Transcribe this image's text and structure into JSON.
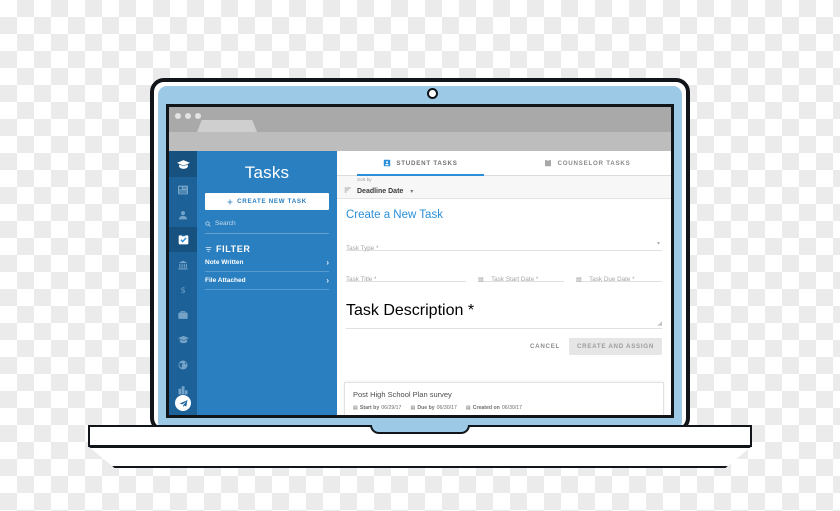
{
  "device": {
    "type": "laptop-mockup",
    "camera": "camera-dot",
    "bezel_color": "#9cc9e5",
    "frame_color": "#111418"
  },
  "browser": {
    "traffic_lights": 3,
    "tab_placeholder": "",
    "url_placeholder": ""
  },
  "rail": {
    "logo_icon": "graduation-cap-icon",
    "items": [
      {
        "icon": "list-icon",
        "active": false
      },
      {
        "icon": "person-icon",
        "active": false
      },
      {
        "icon": "clipboard-check-icon",
        "active": true
      },
      {
        "icon": "bank-icon",
        "active": false
      },
      {
        "icon": "dollar-icon",
        "active": false
      },
      {
        "icon": "briefcase-icon",
        "active": false
      },
      {
        "icon": "graduation-cap-icon",
        "active": false
      },
      {
        "icon": "globe-icon",
        "active": false
      },
      {
        "icon": "chart-building-icon",
        "active": false
      }
    ],
    "fab_icon": "paper-plane-icon"
  },
  "panel": {
    "title": "Tasks",
    "create_button": "CREATE NEW TASK",
    "create_icon": "plus-icon",
    "search_placeholder": "Search",
    "search_icon": "search-icon",
    "filter_heading": "FILTER",
    "filter_icon": "filter-icon",
    "filters": [
      {
        "label": "Note Written",
        "chevron": "chevron-right-icon"
      },
      {
        "label": "File Attached",
        "chevron": "chevron-right-icon"
      }
    ]
  },
  "main": {
    "tabs": [
      {
        "label": "STUDENT TASKS",
        "icon": "clipboard-person-icon",
        "active": true
      },
      {
        "label": "COUNSELOR TASKS",
        "icon": "clipboard-icon",
        "active": false
      }
    ],
    "sort": {
      "label": "Sort by",
      "value": "Deadline Date",
      "icon": "sort-icon",
      "caret": "▾"
    },
    "form": {
      "title": "Create a New Task",
      "task_type_label": "Task Type *",
      "task_type_caret": "▾",
      "task_title_label": "Task Title *",
      "task_start_date_label": "Task Start Date *",
      "task_due_date_label": "Task Due Date *",
      "task_description_label": "Task Description *",
      "calendar_icon": "calendar-icon",
      "cancel_label": "CANCEL",
      "submit_label": "CREATE AND ASSIGN"
    },
    "task_card": {
      "title": "Post High School Plan survey",
      "meta": [
        {
          "icon": "calendar-icon",
          "prefix": "Start by",
          "value": "06/29/17"
        },
        {
          "icon": "calendar-icon",
          "prefix": "Due by",
          "value": "06/30/17"
        },
        {
          "icon": "calendar-icon",
          "prefix": "Created on",
          "value": "06/30/17"
        }
      ]
    }
  },
  "colors": {
    "panel_blue": "#2a7fc0",
    "rail_blue": "#1d6199",
    "accent_blue": "#2a8fd8",
    "bezel_blue": "#9cc9e5"
  }
}
